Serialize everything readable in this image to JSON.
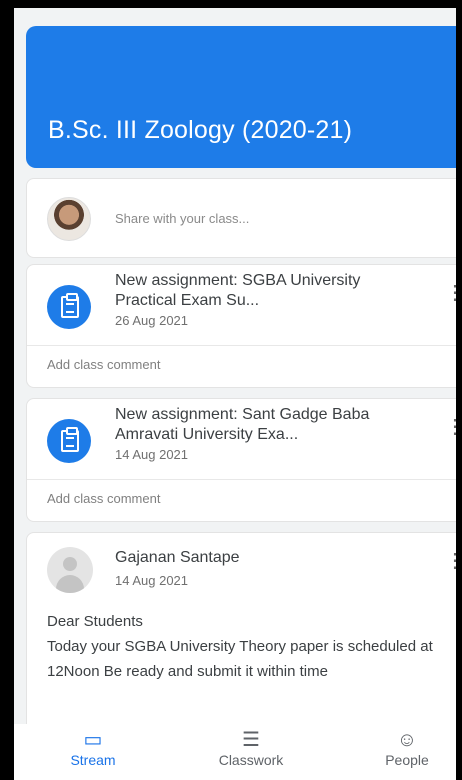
{
  "class": {
    "title": "B.Sc. III Zoology (2020-21)"
  },
  "share": {
    "placeholder": "Share with your class..."
  },
  "posts": [
    {
      "title": "New assignment: SGBA University Practical Exam Su...",
      "date": "26 Aug 2021",
      "comment": "Add class comment"
    },
    {
      "title": "New assignment: Sant Gadge Baba Amravati University Exa...",
      "date": "14 Aug 2021",
      "comment": "Add class comment"
    }
  ],
  "announcement": {
    "author": "Gajanan Santape",
    "date": "14 Aug 2021",
    "line1": "Dear Students",
    "line2": "Today your SGBA University Theory paper is scheduled at 12Noon Be ready and submit it within time"
  },
  "nav": {
    "stream": "Stream",
    "classwork": "Classwork",
    "people": "People"
  },
  "colors": {
    "accent": "#1e7ce8",
    "active_tab": "#1a73e8"
  },
  "icons": [
    "assignment-icon",
    "more-vert-icon",
    "repost-icon",
    "stream-icon",
    "classwork-icon",
    "people-icon"
  ]
}
